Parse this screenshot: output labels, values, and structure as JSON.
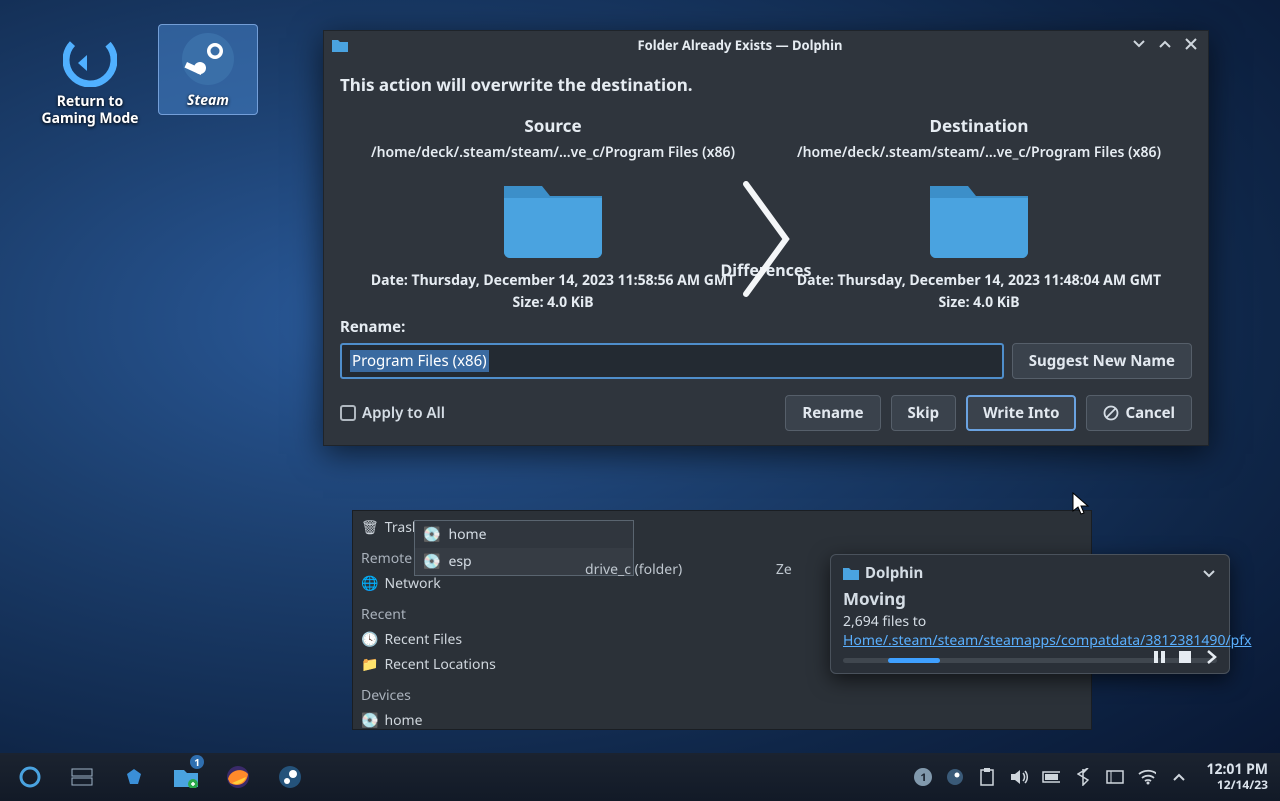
{
  "desktop": {
    "icon_return": "Return to\nGaming Mode",
    "icon_steam": "Steam"
  },
  "dialog": {
    "title": "Folder Already Exists — Dolphin",
    "warning": "This action will overwrite the destination.",
    "source_hdr": "Source",
    "dest_hdr": "Destination",
    "source_path": "/home/deck/.steam/steam/…ve_c/Program Files (x86)",
    "dest_path": "/home/deck/.steam/steam/…ve_c/Program Files (x86)",
    "differences": "Differences",
    "source_date": "Date: Thursday, December 14, 2023 11:58:56 AM GMT",
    "source_size": "Size: 4.0 KiB",
    "dest_date": "Date: Thursday, December 14, 2023 11:48:04 AM GMT",
    "dest_size": "Size: 4.0 KiB",
    "rename_label": "Rename:",
    "rename_value": "Program Files (x86)",
    "suggest_btn": "Suggest New Name",
    "apply_all": "Apply to All",
    "rename_btn": "Rename",
    "skip_btn": "Skip",
    "write_btn": "Write Into",
    "cancel_btn": "Cancel"
  },
  "places": {
    "trash": "Trash",
    "remote": "Remote",
    "network": "Network",
    "recent": "Recent",
    "recent_files": "Recent Files",
    "recent_locations": "Recent Locations",
    "devices": "Devices",
    "home_dev": "home"
  },
  "popup": {
    "home": "home",
    "esp": "esp"
  },
  "content": {
    "drivec": "drive_c (folder)",
    "ze": "Ze"
  },
  "notif": {
    "app": "Dolphin",
    "title": "Moving",
    "count": "2,694 files to ",
    "link": "Home/.steam/steam/steamapps/compatdata/3812381490/pfx"
  },
  "taskbar": {
    "badge": "1",
    "time": "12:01 PM",
    "date": "12/14/23"
  }
}
